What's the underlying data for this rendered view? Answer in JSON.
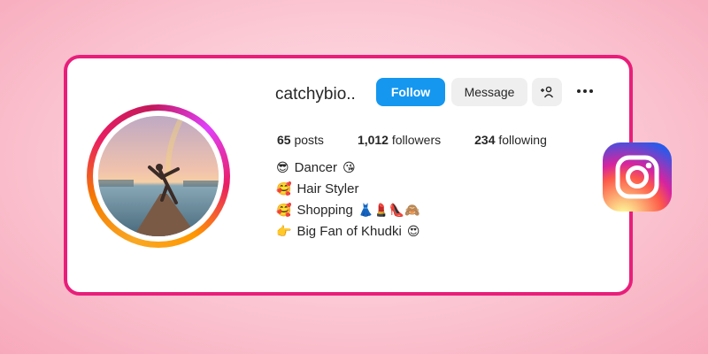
{
  "profile": {
    "username": "catchybio..",
    "follow_label": "Follow",
    "message_label": "Message",
    "stats": {
      "posts_count": "65",
      "posts_label": "posts",
      "followers_count": "1,012",
      "followers_label": "followers",
      "following_count": "234",
      "following_label": "following"
    },
    "bio": [
      {
        "emoji": "😎",
        "text": "Dancer",
        "suffix": "😘"
      },
      {
        "emoji": "🥰",
        "text": "Hair Styler",
        "suffix": ""
      },
      {
        "emoji": "🥰",
        "text": "Shopping",
        "suffix": "👗💄👠🙈"
      },
      {
        "emoji": "👉",
        "text": "Big Fan of Khudki",
        "suffix": "😍"
      }
    ]
  },
  "icons": {
    "add_user": "add-user-icon",
    "more": "more-options-icon",
    "brand": "instagram-logo"
  },
  "colors": {
    "card_border": "#e91e7a",
    "follow_button": "#1597f0",
    "secondary_button": "#efefef"
  }
}
